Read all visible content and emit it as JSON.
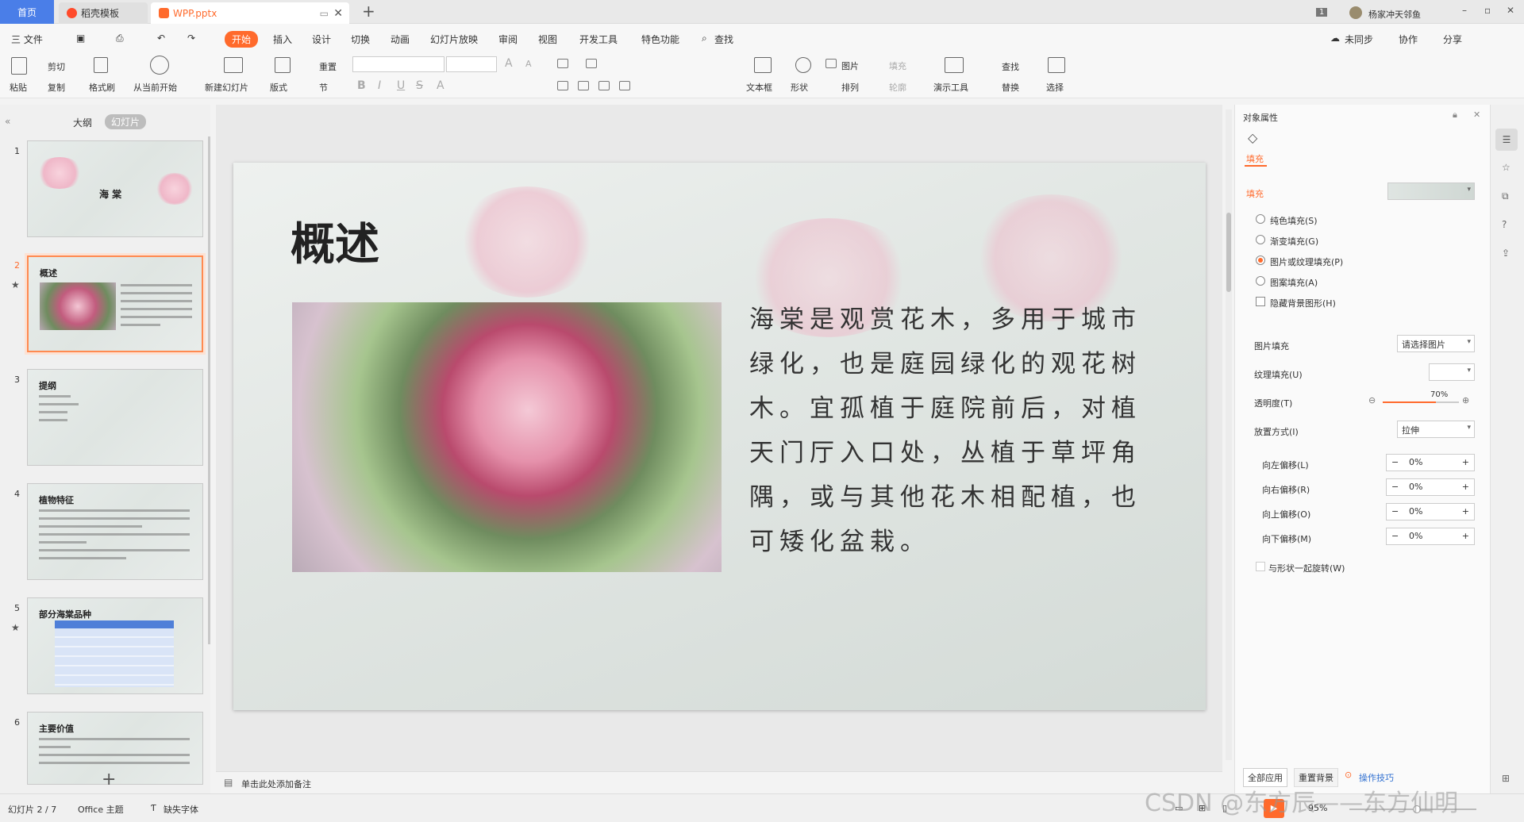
{
  "tabs": {
    "home": "首页",
    "template": "稻壳模板",
    "file": "WPP.pptx",
    "add": "+"
  },
  "user": {
    "badge": "1",
    "name": "杨家冲天邻鱼"
  },
  "menu": {
    "file": "三 文件",
    "start": "开始",
    "items": [
      "插入",
      "设计",
      "切换",
      "动画",
      "幻灯片放映",
      "审阅",
      "视图",
      "开发工具",
      "特色功能"
    ],
    "search": "查找",
    "sync": "未同步",
    "collab": "协作",
    "share": "分享"
  },
  "ribbon": {
    "paste": "粘贴",
    "cut": "剪切",
    "copy": "复制",
    "format_painter": "格式刷",
    "from_current": "从当前开始",
    "new_slide": "新建幻灯片",
    "layout": "版式",
    "reset": "重置",
    "section": "节",
    "text_box": "文本框",
    "shape": "形状",
    "picture": "图片",
    "fill": "填充",
    "arrange": "排列",
    "outline": "轮廓",
    "present_tool": "演示工具",
    "find": "查找",
    "replace": "替换",
    "select": "选择",
    "font_size_a": "A",
    "font_size_b": "A"
  },
  "left": {
    "outline": "大纲",
    "slides": "幻灯片",
    "add": "+"
  },
  "thumbs": [
    {
      "num": "1",
      "title": "海 棠"
    },
    {
      "num": "2",
      "title": "概述"
    },
    {
      "num": "3",
      "title": "提纲"
    },
    {
      "num": "4",
      "title": "植物特征"
    },
    {
      "num": "5",
      "title": "部分海棠品种"
    },
    {
      "num": "6",
      "title": "主要价值"
    }
  ],
  "slide": {
    "title": "概述",
    "text": "海棠是观赏花木，多用于城市绿化，也是庭园绿化的观花树木。宜孤植于庭院前后，对植天门厅入口处，丛植于草坪角隅，或与其他花木相配植，也可矮化盆栽。"
  },
  "notes": "单击此处添加备注",
  "panel": {
    "title": "对象属性",
    "tab_fill": "填充",
    "section_fill": "填充",
    "options": [
      "纯色填充(S)",
      "渐变填充(G)",
      "图片或纹理填充(P)",
      "图案填充(A)"
    ],
    "hide_bg": "隐藏背景图形(H)",
    "pic_fill_label": "图片填充",
    "pic_fill_value": "请选择图片",
    "texture_label": "纹理填充(U)",
    "transparency_label": "透明度(T)",
    "transparency_value": "70%",
    "placement_label": "放置方式(I)",
    "placement_value": "拉伸",
    "offsets": [
      {
        "label": "向左偏移(L)",
        "value": "0%"
      },
      {
        "label": "向右偏移(R)",
        "value": "0%"
      },
      {
        "label": "向上偏移(O)",
        "value": "0%"
      },
      {
        "label": "向下偏移(M)",
        "value": "0%"
      }
    ],
    "rotate": "与形状一起旋转(W)",
    "apply_all": "全部应用",
    "reset_bg": "重置背景",
    "tips": "操作技巧"
  },
  "status": {
    "slide": "幻灯片 2 / 7",
    "theme": "Office 主题",
    "font": "缺失字体",
    "zoom": "95%",
    "watermark": "CSDN @东方辰——东方仙明"
  },
  "colors": {
    "accent": "#ff6a2c",
    "home_tab": "#4a7ee8"
  }
}
